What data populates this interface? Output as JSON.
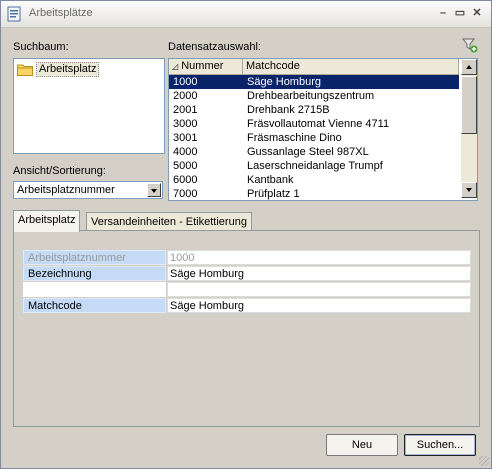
{
  "window": {
    "title": "Arbeitsplätze"
  },
  "labels": {
    "tree": "Suchbaum:",
    "records": "Datensatzauswahl:",
    "sort": "Ansicht/Sortierung:"
  },
  "tree": {
    "root": "Arbeitsplatz"
  },
  "sort": {
    "value": "Arbeitsplatznummer"
  },
  "grid": {
    "columns": [
      "Nummer",
      "Matchcode"
    ],
    "rows": [
      {
        "nummer": "1000",
        "matchcode": "Säge Homburg",
        "selected": true
      },
      {
        "nummer": "2000",
        "matchcode": "Drehbearbeitungszentrum"
      },
      {
        "nummer": "2001",
        "matchcode": "Drehbank 2715B"
      },
      {
        "nummer": "3000",
        "matchcode": "Fräsvollautomat Vienne 4711"
      },
      {
        "nummer": "3001",
        "matchcode": "Fräsmaschine Dino"
      },
      {
        "nummer": "4000",
        "matchcode": "Gussanlage Steel 987XL"
      },
      {
        "nummer": "5000",
        "matchcode": "Laserschneidanlage Trumpf"
      },
      {
        "nummer": "6000",
        "matchcode": "Kantbank"
      },
      {
        "nummer": "7000",
        "matchcode": "Prüfplatz 1"
      }
    ]
  },
  "tabs": [
    "Arbeitsplatz",
    "Versandeinheiten - Etikettierung"
  ],
  "details": {
    "nummer_label": "Arbeitsplatznummer",
    "nummer_value": "1000",
    "bez_label": "Bezeichnung",
    "bez_value": "Säge Homburg",
    "mc_label": "Matchcode",
    "mc_value": "Säge Homburg"
  },
  "buttons": {
    "neu": "Neu",
    "suchen": "Suchen..."
  },
  "colors": {
    "selection": "#0a246a",
    "property_label": "#c4daf5"
  }
}
